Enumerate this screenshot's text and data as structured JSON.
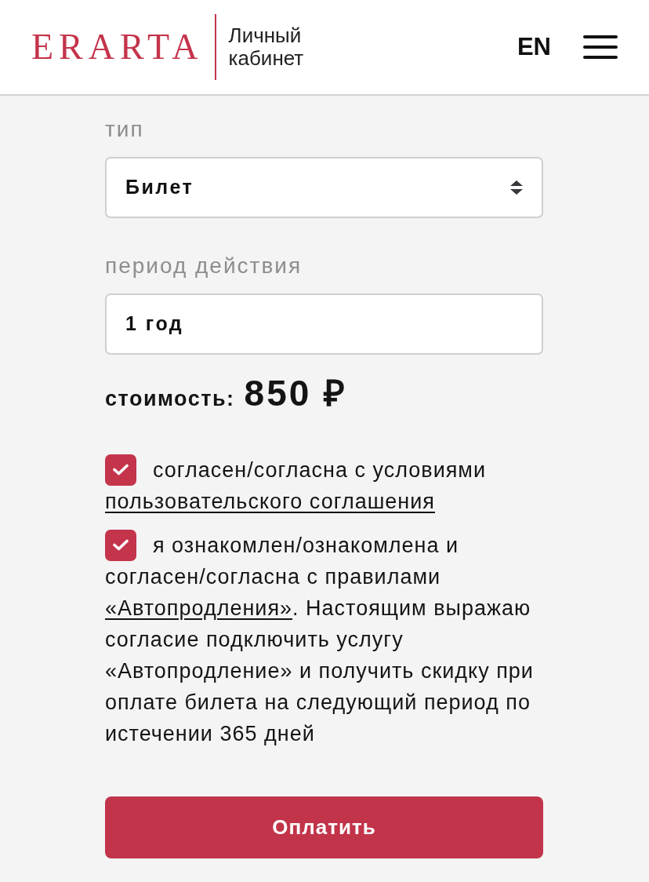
{
  "header": {
    "logo": "ERARTA",
    "subtitle": "Личный кабинет",
    "language": "EN"
  },
  "form": {
    "fields": [
      {
        "kind": "select",
        "label": "тип",
        "value": "Билет"
      },
      {
        "kind": "input",
        "label": "период действия",
        "value": "1 год"
      }
    ],
    "price": {
      "label": "стоимость:",
      "value": "850 ₽"
    },
    "agreements": [
      {
        "checked": true,
        "lead": "согласен/согласна с условиями",
        "parts": [
          {
            "kind": "link",
            "text": "пользовательского соглашения"
          }
        ]
      },
      {
        "checked": true,
        "lead": "я ознакомлен/ознакомлена и",
        "parts": [
          {
            "kind": "text",
            "text": "согласен/согласна с правилами "
          },
          {
            "kind": "link",
            "text": "«Автопродления»"
          },
          {
            "kind": "text",
            "text": ". Настоящим выражаю согласие подключить услугу «Автопродление» и получить скидку при оплате билета на следующий период по истечении 365 дней"
          }
        ]
      }
    ],
    "submit": "Оплатить"
  }
}
